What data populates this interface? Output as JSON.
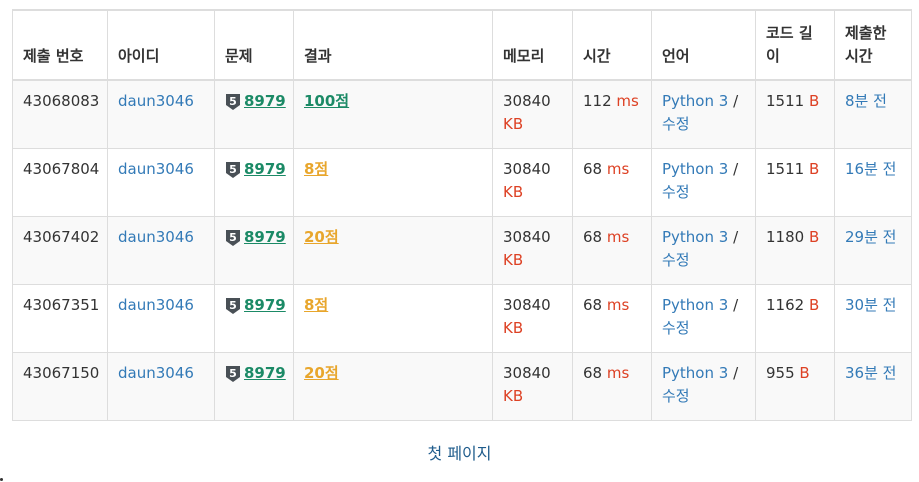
{
  "table": {
    "headers": [
      "제출 번호",
      "아이디",
      "문제",
      "결과",
      "메모리",
      "시간",
      "언어",
      "코드 길이",
      "제출한 시간"
    ],
    "rows": [
      {
        "id": "43068083",
        "user": "daun3046",
        "tier": "5",
        "problem": "8979",
        "result": "100점",
        "result_type": "full",
        "memory": "30840",
        "memory_unit": "KB",
        "time": "112",
        "time_unit": "ms",
        "lang": "Python 3",
        "edit": "수정",
        "code_len": "1511",
        "code_unit": "B",
        "submitted": "8분 전"
      },
      {
        "id": "43067804",
        "user": "daun3046",
        "tier": "5",
        "problem": "8979",
        "result": "8점",
        "result_type": "partial",
        "memory": "30840",
        "memory_unit": "KB",
        "time": "68",
        "time_unit": "ms",
        "lang": "Python 3",
        "edit": "수정",
        "code_len": "1511",
        "code_unit": "B",
        "submitted": "16분 전"
      },
      {
        "id": "43067402",
        "user": "daun3046",
        "tier": "5",
        "problem": "8979",
        "result": "20점",
        "result_type": "partial",
        "memory": "30840",
        "memory_unit": "KB",
        "time": "68",
        "time_unit": "ms",
        "lang": "Python 3",
        "edit": "수정",
        "code_len": "1180",
        "code_unit": "B",
        "submitted": "29분 전"
      },
      {
        "id": "43067351",
        "user": "daun3046",
        "tier": "5",
        "problem": "8979",
        "result": "8점",
        "result_type": "partial",
        "memory": "30840",
        "memory_unit": "KB",
        "time": "68",
        "time_unit": "ms",
        "lang": "Python 3",
        "edit": "수정",
        "code_len": "1162",
        "code_unit": "B",
        "submitted": "30분 전"
      },
      {
        "id": "43067150",
        "user": "daun3046",
        "tier": "5",
        "problem": "8979",
        "result": "20점",
        "result_type": "partial",
        "memory": "30840",
        "memory_unit": "KB",
        "time": "68",
        "time_unit": "ms",
        "lang": "Python 3",
        "edit": "수정",
        "code_len": "955",
        "code_unit": "B",
        "submitted": "36분 전"
      }
    ]
  },
  "pager": {
    "first_page": "첫 페이지"
  },
  "colors": {
    "link": "#337ab7",
    "unit": "#dd4124",
    "accepted": "#1b8a66",
    "partial": "#e8a62c",
    "tier_badge": "#495056"
  },
  "icons": {
    "tier_badge": "silver-tier-badge-icon"
  }
}
